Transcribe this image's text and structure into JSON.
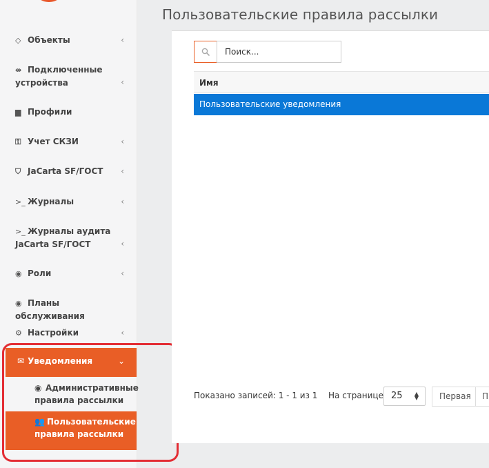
{
  "page": {
    "title": "Пользовательские правила рассылки"
  },
  "sidebar": {
    "items": [
      {
        "icon": "diamond-icon",
        "glyph": "◇",
        "label": "Объекты",
        "chevron": "‹"
      },
      {
        "icon": "usb-icon",
        "glyph": "⇴",
        "label": "Подключенные устройства",
        "chevron": "‹"
      },
      {
        "icon": "folder-icon",
        "glyph": "▆",
        "label": "Профили",
        "chevron": ""
      },
      {
        "icon": "key-icon",
        "glyph": "⚿",
        "label": "Учет СКЗИ",
        "chevron": "‹"
      },
      {
        "icon": "shield-icon",
        "glyph": "⛉",
        "label": "JaCarta SF/ГОСТ",
        "chevron": "‹"
      },
      {
        "icon": "terminal-icon",
        "glyph": ">_",
        "label": "Журналы",
        "chevron": "‹"
      },
      {
        "icon": "terminal-icon",
        "glyph": ">_",
        "label": "Журналы аудита JaCarta SF/ГОСТ",
        "chevron": "‹"
      },
      {
        "icon": "user-circle-icon",
        "glyph": "◉",
        "label": "Роли",
        "chevron": "‹"
      },
      {
        "icon": "user-circle-icon",
        "glyph": "◉",
        "label": "Планы обслуживания",
        "chevron": ""
      },
      {
        "icon": "gears-icon",
        "glyph": "⚙",
        "label": "Настройки",
        "chevron": "‹"
      }
    ],
    "active_section": {
      "icon": "envelope-icon",
      "glyph": "✉",
      "label": "Уведомления",
      "chevron": "⌄"
    },
    "submenu": [
      {
        "icon": "user-circle-icon",
        "glyph": "◉",
        "label": "Административные правила рассылки"
      },
      {
        "icon": "users-icon",
        "glyph": "👥",
        "label": "Пользовательские правила рассылки"
      }
    ]
  },
  "search": {
    "icon": "search-icon",
    "placeholder": "Поиск..."
  },
  "table": {
    "columns": [
      "Имя"
    ],
    "rows": [
      [
        "Пользовательские уведомления"
      ]
    ]
  },
  "footer": {
    "records_label": "Показано записей: 1 - 1 из 1",
    "per_page_label": "На странице:",
    "per_page_value": "25",
    "first_button": "Первая",
    "prev_button": "П"
  },
  "colors": {
    "accent": "#e95e26",
    "selected_row": "#0a78d7",
    "highlight_border": "#e32d34"
  }
}
